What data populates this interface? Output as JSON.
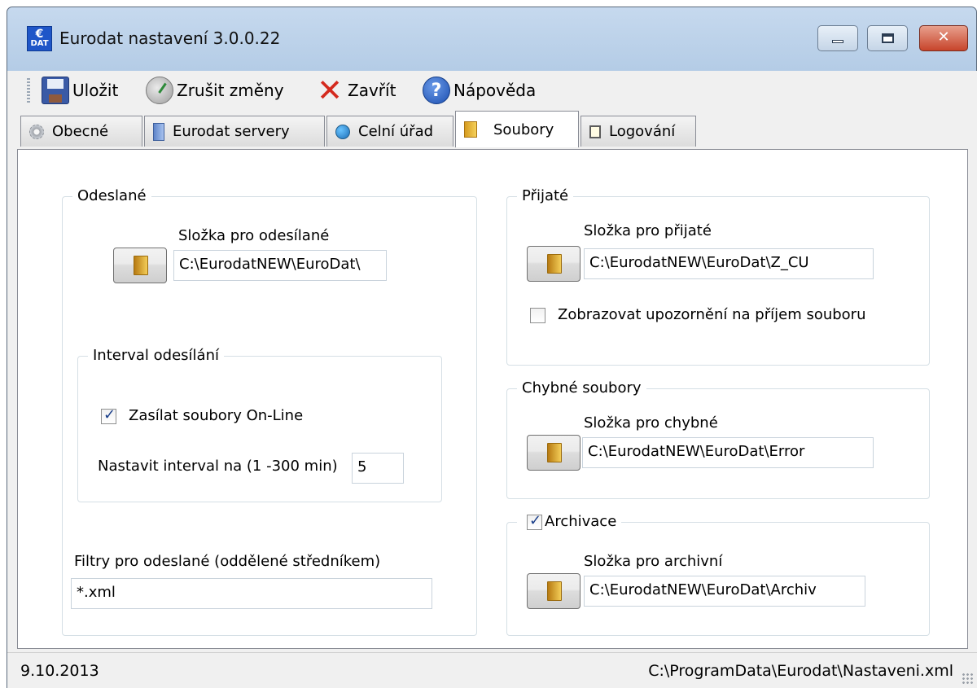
{
  "window": {
    "title": "Eurodat nastavení 3.0.0.22",
    "app_icon_text": "€",
    "app_icon_sub": "DAT",
    "buttons": {
      "minimize": "minimize",
      "maximize": "maximize",
      "close": "✕"
    }
  },
  "toolbar": {
    "save": "Uložit",
    "undo": "Zrušit změny",
    "close": "Zavřít",
    "help": "Nápověda",
    "help_glyph": "?",
    "close_glyph": "✕"
  },
  "tabs": [
    {
      "label": "Obecné",
      "icon": "gear-icon"
    },
    {
      "label": "Eurodat servery",
      "icon": "server-icon"
    },
    {
      "label": "Celní úřad",
      "icon": "globe-icon"
    },
    {
      "label": "Soubory",
      "icon": "folder-icon",
      "active": true
    },
    {
      "label": "Logování",
      "icon": "log-icon"
    }
  ],
  "sent": {
    "title": "Odeslané",
    "folder_label": "Složka pro odesílané",
    "folder_value": "C:\\EurodatNEW\\EuroDat\\",
    "interval": {
      "title": "Interval odesílání",
      "online_label": "Zasílat soubory On-Line",
      "online_checked": true,
      "interval_label": "Nastavit interval na (1 -300 min)",
      "interval_value": "5"
    },
    "filters_label": "Filtry pro odeslané (oddělené středníkem)",
    "filters_value": "*.xml"
  },
  "received": {
    "title": "Přijaté",
    "folder_label": "Složka pro přijaté",
    "folder_value": "C:\\EurodatNEW\\EuroDat\\Z_CU",
    "notify_label": "Zobrazovat upozornění na příjem souboru",
    "notify_checked": false
  },
  "errors": {
    "title": "Chybné soubory",
    "folder_label": "Složka pro chybné",
    "folder_value": "C:\\EurodatNEW\\EuroDat\\Error"
  },
  "archive": {
    "title": "Archivace",
    "enabled": true,
    "folder_label": "Složka pro archivní",
    "folder_value": "C:\\EurodatNEW\\EuroDat\\Archiv"
  },
  "status": {
    "date": "9.10.2013",
    "path": "C:\\ProgramData\\Eurodat\\Nastaveni.xml"
  }
}
